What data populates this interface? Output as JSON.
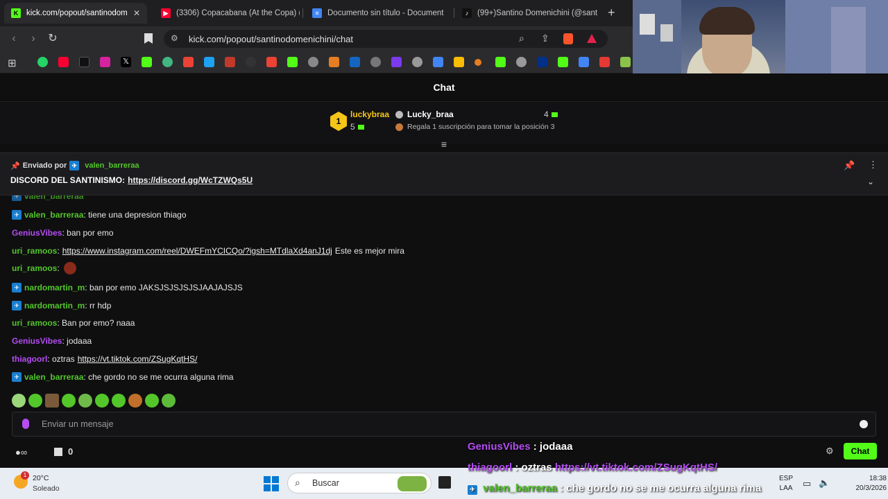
{
  "tabs": [
    {
      "title": "kick.com/popout/santinodom",
      "active": true
    },
    {
      "title": "(3306) Copacabana (At the Copa) (",
      "active": false
    },
    {
      "title": "Documento sin título - Document",
      "active": false
    },
    {
      "title": "(99+)Santino Domenichini (@sant",
      "active": false
    }
  ],
  "address": {
    "url": "kick.com/popout/santinodomenichini/chat"
  },
  "chat": {
    "title": "Chat",
    "leaderboard": {
      "rank": "1",
      "user": "luckybraa",
      "user_count": "5",
      "gifter": "Lucky_braa",
      "gifter_count": "4",
      "prompt": "Regala 1 suscripción para tomar la posición 3"
    },
    "pinned": {
      "sent_by_label": "Enviado por",
      "sent_by_user": "valen_barreraa",
      "text": "DISCORD DEL SANTINISMO:",
      "link": "https://discord.gg/WcTZWQs5U"
    },
    "messages": [
      {
        "user": "valen_barreraa",
        "color": "#53c62a",
        "badge": true,
        "text": ": tiene una depresion thiago",
        "link": ""
      },
      {
        "user": "GeniusVibes",
        "color": "#b44df2",
        "badge": false,
        "text": ": ban por emo",
        "link": ""
      },
      {
        "user": "uri_ramoos",
        "color": "#53c62a",
        "badge": false,
        "text": ":",
        "link": "https://www.instagram.com/reel/DWEFmYCICQo/?igsh=MTdlaXd4anJ1dj",
        "after": "Este es mejor mira"
      },
      {
        "user": "uri_ramoos",
        "color": "#53c62a",
        "badge": false,
        "text": ":",
        "link": ""
      },
      {
        "user": "nardomartin_m",
        "color": "#53c62a",
        "badge": true,
        "text": ": ban por emo JAKSJSJSJSJSJAAJAJSJS",
        "link": ""
      },
      {
        "user": "nardomartin_m",
        "color": "#53c62a",
        "badge": true,
        "text": ": rr hdp",
        "link": ""
      },
      {
        "user": "uri_ramoos",
        "color": "#53c62a",
        "badge": false,
        "text": ": Ban por emo? naaa",
        "link": ""
      },
      {
        "user": "GeniusVibes",
        "color": "#b44df2",
        "badge": false,
        "text": ": jodaaa",
        "link": ""
      },
      {
        "user": "thiagoorl",
        "color": "#b44df2",
        "badge": false,
        "text": ": oztras",
        "link": "https://vt.tiktok.com/ZSugKqtHS/"
      },
      {
        "user": "valen_barreraa",
        "color": "#53c62a",
        "badge": true,
        "text": ": che gordo no se me ocurra alguna rima",
        "link": ""
      }
    ],
    "input_placeholder": "Enviar un mensaje",
    "footer_count": "0",
    "send_label": "Chat"
  },
  "overlay": [
    {
      "user": "GeniusVibes",
      "color": "#b44df2",
      "text": ": jodaaa",
      "link": ""
    },
    {
      "user": "thiagoorl",
      "color": "#b44df2",
      "text": ": oztras",
      "link": "https://vt.tiktok.com/ZSugKqtHS/"
    },
    {
      "user": "valen_barreraa",
      "color": "#53c62a",
      "text": ": che gordo no se me ocurra alguna rima",
      "link": ""
    }
  ],
  "taskbar": {
    "weather_temp": "20°C",
    "weather_desc": "Soleado",
    "search_label": "Buscar",
    "lang_top": "ESP",
    "lang_bottom": "LAA",
    "time": "18:38",
    "date": "20/3/2026"
  }
}
